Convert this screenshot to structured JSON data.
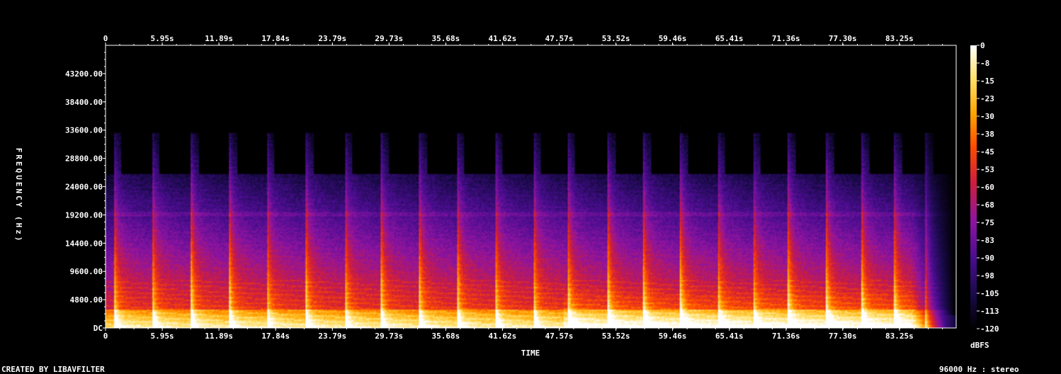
{
  "chart_data": {
    "type": "heatmap",
    "title": "",
    "xlabel": "TIME",
    "ylabel": "FREQUENCY (Hz)",
    "x_tick_labels": [
      "0",
      "5.95s",
      "11.89s",
      "17.84s",
      "23.79s",
      "29.73s",
      "35.68s",
      "41.62s",
      "47.57s",
      "53.52s",
      "59.46s",
      "65.41s",
      "71.36s",
      "77.30s",
      "83.25s"
    ],
    "x_ticks_seconds": [
      0,
      5.95,
      11.89,
      17.84,
      23.79,
      29.73,
      35.68,
      41.62,
      47.57,
      53.52,
      59.46,
      65.41,
      71.36,
      77.3,
      83.25
    ],
    "xlim": [
      0,
      89.2
    ],
    "y_tick_labels": [
      "DC",
      "4800.00",
      "9600.00",
      "14400.00",
      "19200.00",
      "24000.00",
      "28800.00",
      "33600.00",
      "38400.00",
      "43200.00"
    ],
    "y_ticks_hz": [
      0,
      4800,
      9600,
      14400,
      19200,
      24000,
      28800,
      33600,
      38400,
      43200
    ],
    "ylim": [
      0,
      48000
    ],
    "colorbar": {
      "unit": "dBFS",
      "tick_labels": [
        "0",
        "-8",
        "-15",
        "-23",
        "-30",
        "-38",
        "-45",
        "-53",
        "-60",
        "-68",
        "-75",
        "-83",
        "-90",
        "-98",
        "-105",
        "-113",
        "-120"
      ],
      "range": [
        -120,
        0
      ],
      "colormap": [
        "#000000",
        "#1a0a4a",
        "#4a0d8f",
        "#8e14a0",
        "#d01e3a",
        "#ff4a00",
        "#ffa500",
        "#ffe066",
        "#ffffff"
      ]
    },
    "note_onsets_seconds": [
      0.8,
      4.8,
      8.9,
      12.9,
      16.8,
      20.9,
      25.0,
      28.8,
      32.8,
      36.8,
      40.8,
      44.8,
      48.4,
      52.6,
      56.3,
      60.2,
      64.1,
      67.8,
      71.5,
      75.5,
      79.2,
      82.6,
      85.9
    ],
    "sample_rate_hz": 96000,
    "channels": "stereo"
  },
  "footer": {
    "created_by": "CREATED BY LIBAVFILTER",
    "format": "96000 Hz : stereo"
  }
}
